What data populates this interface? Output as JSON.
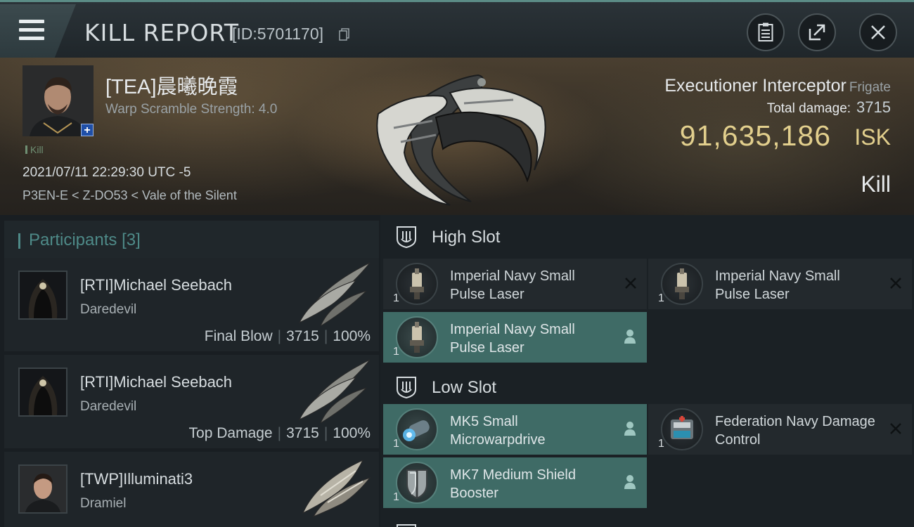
{
  "header": {
    "title": "KILL REPORT",
    "kill_id": "[ID:5701170]",
    "icons": [
      "menu-icon",
      "copy-icon",
      "clipboard-icon",
      "share-icon",
      "close-icon"
    ]
  },
  "victim": {
    "name": "[TEA]晨曦晚霞",
    "detail": "Warp Scramble Strength: 4.0",
    "tag": "Kill",
    "datetime": "2021/07/11 22:29:30 UTC -5",
    "location": "P3EN-E < Z-DO53 < Vale of the Silent",
    "ship": "Executioner Interceptor",
    "ship_class": "Frigate",
    "total_damage_label": "Total damage:",
    "total_damage": "3715",
    "isk_value": "91,635,186",
    "isk_label": "ISK",
    "result": "Kill"
  },
  "participants": {
    "title": "Participants",
    "count": "[3]",
    "items": [
      {
        "name": "[RTI]Michael Seebach",
        "ship": "Daredevil",
        "role": "Final Blow",
        "damage": "3715",
        "percent": "100%"
      },
      {
        "name": "[RTI]Michael Seebach",
        "ship": "Daredevil",
        "role": "Top Damage",
        "damage": "3715",
        "percent": "100%"
      },
      {
        "name": "[TWP]Illuminati3",
        "ship": "Dramiel"
      }
    ]
  },
  "slots": {
    "high_label": "High Slot",
    "low_label": "Low Slot",
    "high": [
      {
        "name": "Imperial Navy Small Pulse Laser",
        "qty": "1",
        "state": "destroyed"
      },
      {
        "name": "Imperial Navy Small Pulse Laser",
        "qty": "1",
        "state": "destroyed"
      },
      {
        "name": "Imperial Navy Small Pulse Laser",
        "qty": "1",
        "state": "dropped"
      }
    ],
    "low": [
      {
        "name": "MK5 Small Microwarpdrive",
        "qty": "1",
        "state": "dropped"
      },
      {
        "name": "Federation Navy Damage Control",
        "qty": "1",
        "state": "destroyed"
      },
      {
        "name": "MK7 Medium Shield Booster",
        "qty": "1",
        "state": "dropped"
      }
    ]
  },
  "colors": {
    "accent": "#4e8a88",
    "isk": "#e2cf8d",
    "fitted_bg": "#3f6b66"
  }
}
